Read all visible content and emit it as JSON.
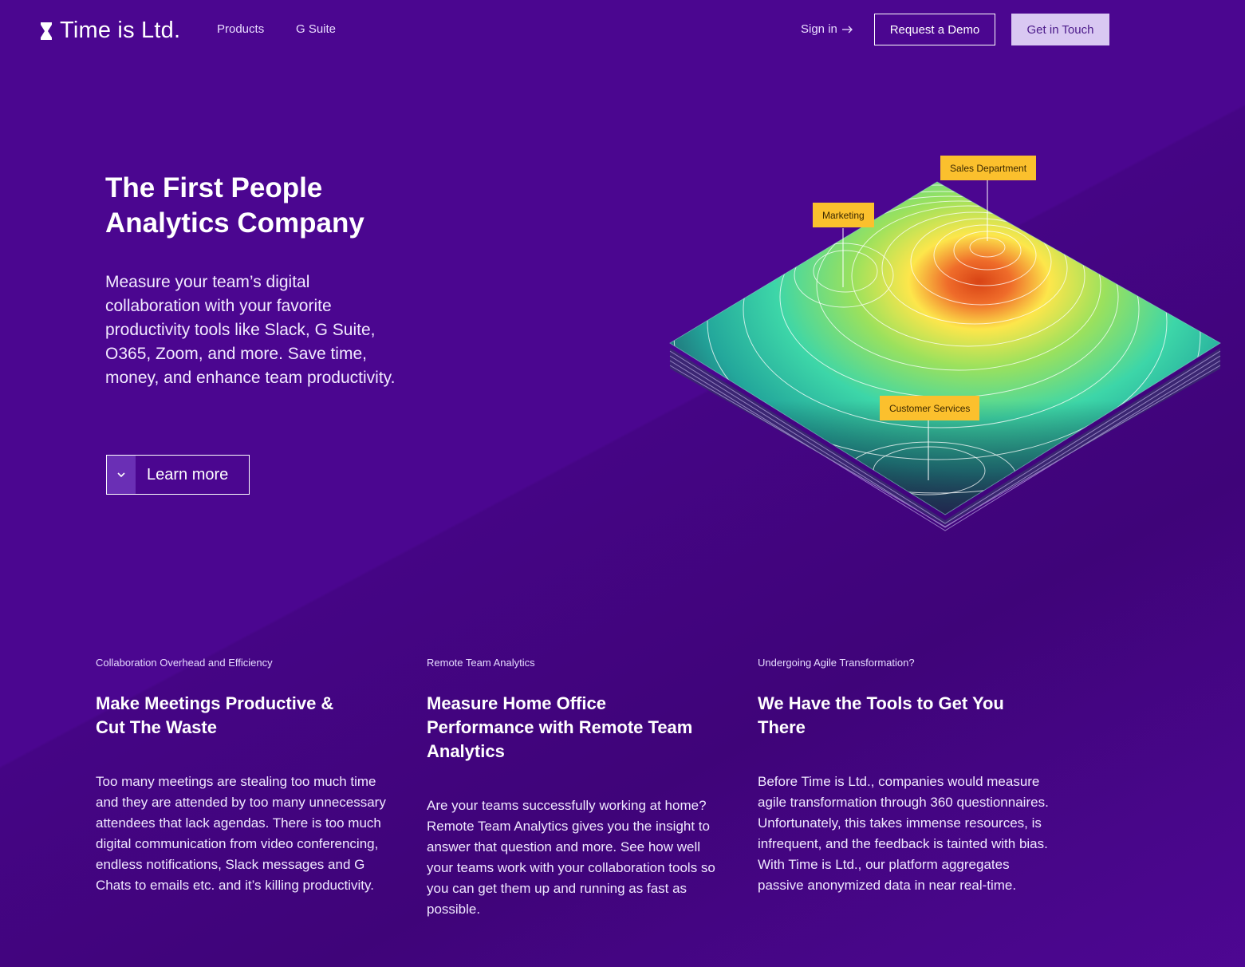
{
  "brand": {
    "name": "Time is Ltd.",
    "icon": "hourglass-icon"
  },
  "nav": {
    "links": [
      "Products",
      "G Suite"
    ],
    "signin": "Sign in",
    "signin_icon": "arrow-right-icon",
    "demo": "Request a Demo",
    "touch": "Get in Touch"
  },
  "hero": {
    "title_line1": "The First People",
    "title_line2": "Analytics Company",
    "text": "Measure your team’s digital collaboration with your favorite productivity tools like Slack, G Suite, O365,  Zoom, and more. Save time, money, and enhance team productivity.",
    "cta": "Learn more"
  },
  "map": {
    "tags": [
      "Sales Department",
      "Marketing",
      "Customer Services"
    ]
  },
  "features": [
    {
      "eyebrow": "Collaboration Overhead and Efficiency",
      "title": "Make Meetings Productive & Cut The Waste",
      "body": "Too many meetings are stealing too much time and they are attended by too many unnecessary attendees that lack agendas. There is too much digital communication from video conferencing, endless notifications, Slack messages and G Chats  to emails etc. and it’s killing productivity."
    },
    {
      "eyebrow": "Remote Team Analytics",
      "title": "Measure Home Office Performance with Remote Team Analytics",
      "body": "Are your teams successfully working at home? Remote Team Analytics gives you the insight to answer that question and more. See how well your teams work with your collaboration tools so you can get them up and running as fast as possible."
    },
    {
      "eyebrow": "Undergoing Agile Transformation?",
      "title": "We Have the Tools to Get You There",
      "body": "Before Time is Ltd., companies would measure agile transformation through 360 questionnaires. Unfortunately, this takes immense resources, is infrequent, and the feedback is tainted with bias. With Time is Ltd., our platform aggregates passive anonymized data in near real-time."
    }
  ],
  "colors": {
    "background": "#4b0690",
    "tag": "#fbc02d",
    "touch_button": "#d9c8f2"
  }
}
